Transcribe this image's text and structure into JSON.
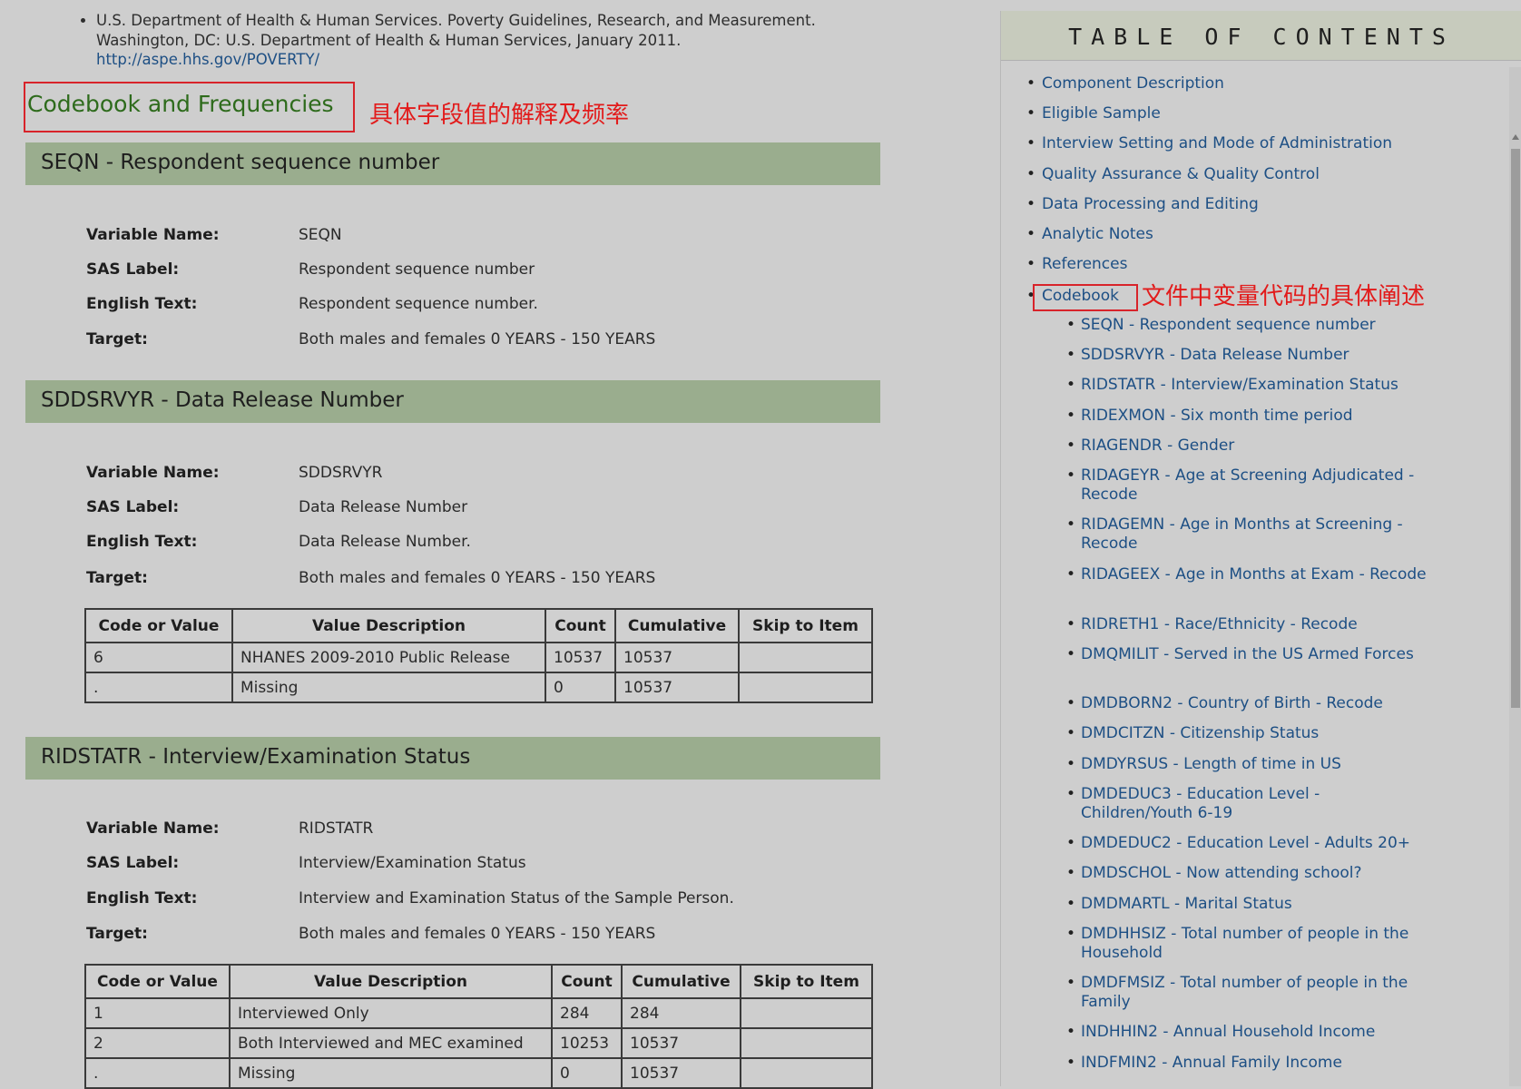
{
  "references": {
    "text": "U.S. Department of Health & Human Services. Poverty Guidelines, Research, and Measurement. Washington, DC: U.S. Department of Health & Human Services, January 2011.",
    "url": "http://aspe.hhs.gov/POVERTY/"
  },
  "section": {
    "title": "Codebook and Frequencies",
    "annotation_cn": "具体字段值的解释及频率"
  },
  "labels": {
    "variable_name": "Variable Name:",
    "sas_label": "SAS Label:",
    "english_text": "English Text:",
    "target": "Target:"
  },
  "table_headers": [
    "Code or Value",
    "Value Description",
    "Count",
    "Cumulative",
    "Skip to Item"
  ],
  "variables": [
    {
      "heading": "SEQN - Respondent sequence number",
      "variable_name": "SEQN",
      "sas_label": "Respondent sequence number",
      "english_text": "Respondent sequence number.",
      "target": "Both males and females 0 YEARS - 150 YEARS",
      "rows": []
    },
    {
      "heading": "SDDSRVYR - Data Release Number",
      "variable_name": "SDDSRVYR",
      "sas_label": "Data Release Number",
      "english_text": "Data Release Number.",
      "target": "Both males and females 0 YEARS - 150 YEARS",
      "rows": [
        {
          "code": "6",
          "desc": "NHANES 2009-2010 Public Release",
          "count": "10537",
          "cum": "10537",
          "skip": ""
        },
        {
          "code": ".",
          "desc": "Missing",
          "count": "0",
          "cum": "10537",
          "skip": ""
        }
      ]
    },
    {
      "heading": "RIDSTATR - Interview/Examination Status",
      "variable_name": "RIDSTATR",
      "sas_label": "Interview/Examination Status",
      "english_text": "Interview and Examination Status of the Sample Person.",
      "target": "Both males and females 0 YEARS - 150 YEARS",
      "rows": [
        {
          "code": "1",
          "desc": "Interviewed Only",
          "count": "284",
          "cum": "284",
          "skip": ""
        },
        {
          "code": "2",
          "desc": "Both Interviewed and MEC examined",
          "count": "10253",
          "cum": "10537",
          "skip": ""
        },
        {
          "code": ".",
          "desc": "Missing",
          "count": "0",
          "cum": "10537",
          "skip": ""
        }
      ]
    }
  ],
  "toc": {
    "title": "TABLE OF CONTENTS",
    "codebook_annotation_cn": "文件中变量代码的具体阐述",
    "items": [
      "Component Description",
      "Eligible Sample",
      "Interview Setting and Mode of Administration",
      "Quality Assurance & Quality Control",
      "Data Processing and Editing",
      "Analytic Notes",
      "References",
      "Codebook"
    ],
    "sub_items": [
      "SEQN - Respondent sequence number",
      "SDDSRVYR - Data Release Number",
      "RIDSTATR - Interview/Examination Status",
      "RIDEXMON - Six month time period",
      "RIAGENDR - Gender",
      "RIDAGEYR - Age at Screening Adjudicated - Recode",
      "RIDAGEMN - Age in Months at Screening - Recode",
      "RIDAGEEX - Age in Months at Exam - Recode",
      "RIDRETH1 - Race/Ethnicity - Recode",
      "DMQMILIT - Served in the US Armed Forces",
      "DMDBORN2 - Country of Birth - Recode",
      "DMDCITZN - Citizenship Status",
      "DMDYRSUS - Length of time in US",
      "DMDEDUC3 - Education Level - Children/Youth 6-19",
      "DMDEDUC2 - Education Level - Adults 20+",
      "DMDSCHOL - Now attending school?",
      "DMDMARTL - Marital Status",
      "DMDHHSIZ - Total number of people in the Household",
      "DMDFMSIZ - Total number of people in the Family",
      "INDHHIN2 - Annual Household Income",
      "INDFMIN2 - Annual Family Income"
    ]
  },
  "colors": {
    "variable_bar": "#9aad8e",
    "link": "#1d4f84",
    "annotation": "#e21b1b",
    "section_title": "#2e6b1c"
  }
}
